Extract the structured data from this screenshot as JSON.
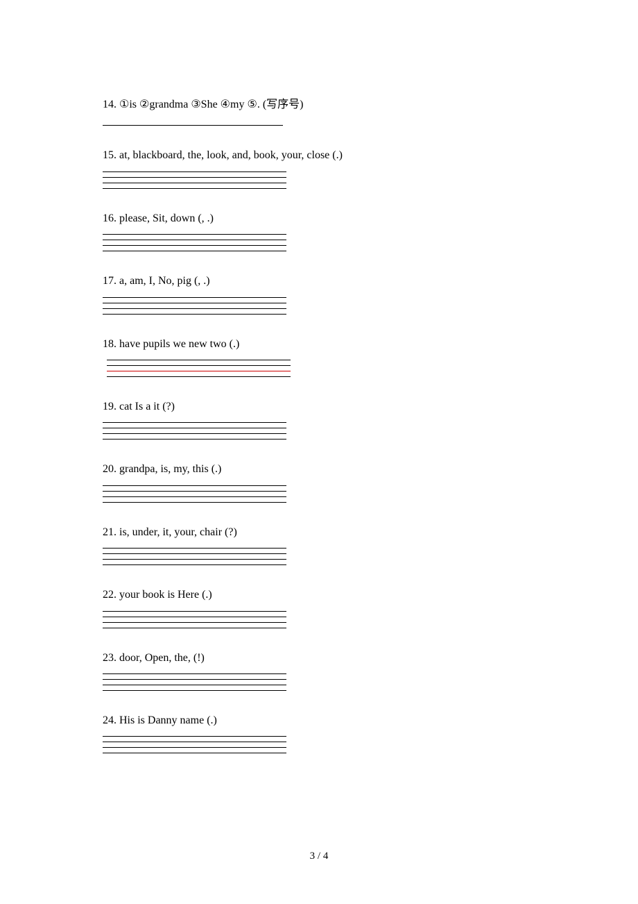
{
  "questions": [
    {
      "num": "14.",
      "text": "①is  ②grandma  ③She  ④my  ⑤. (写序号)",
      "style": "single"
    },
    {
      "num": "15.",
      "text": "at, blackboard, the, look, and, book, your, close (.)",
      "style": "four"
    },
    {
      "num": "16.",
      "text": "please, Sit, down (, .)",
      "style": "four"
    },
    {
      "num": "17.",
      "text": "a, am, I, No, pig (, .)",
      "style": "four"
    },
    {
      "num": "18.",
      "text": "have   pupils   we   new   two (.)",
      "style": "four",
      "indentLines": true,
      "redLine": true
    },
    {
      "num": "19.",
      "text": "cat   Is   a   it (?)",
      "style": "four"
    },
    {
      "num": "20.",
      "text": "grandpa, is, my, this (.)",
      "style": "four"
    },
    {
      "num": "21.",
      "text": "is, under, it, your, chair (?)",
      "style": "four"
    },
    {
      "num": "22.",
      "text": "your   book is   Here (.)",
      "style": "four"
    },
    {
      "num": "23.",
      "text": "door, Open, the, (!)",
      "style": "four"
    },
    {
      "num": "24.",
      "text": "His   is   Danny   name (.)",
      "style": "four"
    }
  ],
  "pageNumber": "3 / 4"
}
